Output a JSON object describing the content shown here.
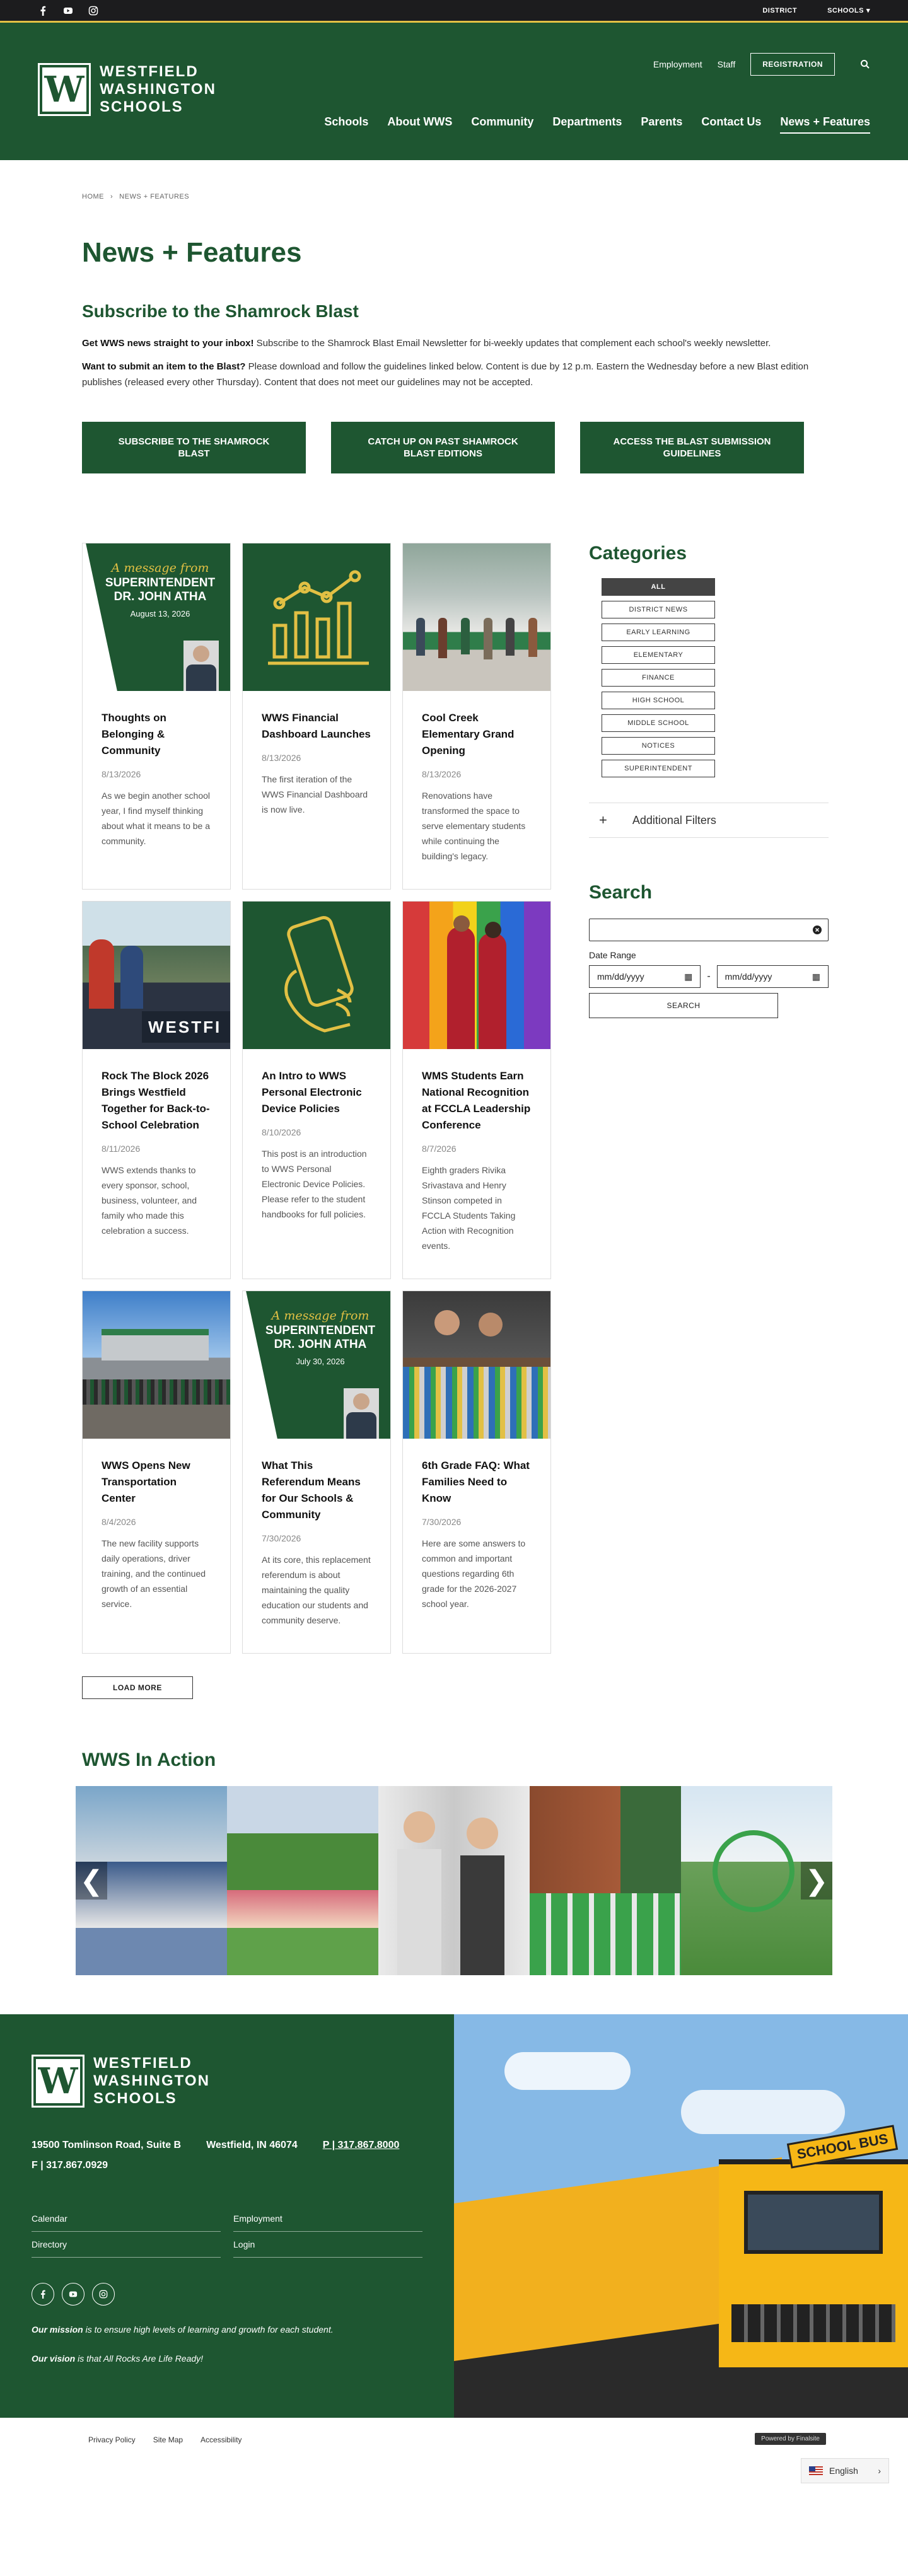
{
  "topbar": {
    "district": "DISTRICT",
    "schools": "SCHOOLS"
  },
  "brand": {
    "line1": "WESTFIELD",
    "line2": "WASHINGTON",
    "line3": "SCHOOLS",
    "mark": "W"
  },
  "util": {
    "employment": "Employment",
    "staff": "Staff",
    "registration": "REGISTRATION"
  },
  "nav": [
    "Schools",
    "About WWS",
    "Community",
    "Departments",
    "Parents",
    "Contact Us",
    "News + Features"
  ],
  "breadcrumb": {
    "home": "HOME",
    "current": "NEWS + FEATURES"
  },
  "page": {
    "title": "News + Features",
    "subtitle": "Subscribe to the Shamrock Blast",
    "p1_bold": "Get WWS news straight to your inbox!",
    "p1_text": " Subscribe to the Shamrock Blast Email Newsletter for bi-weekly updates that complement each school's weekly newsletter.",
    "p2_bold": "Want to submit an item to the Blast?",
    "p2_text": " Please download and follow the guidelines linked below. Content is due by 12 p.m. Eastern the Wednesday before a new Blast edition publishes (released every other Thursday). Content that does not meet our guidelines may not be accepted."
  },
  "ctas": [
    "SUBSCRIBE TO THE SHAMROCK BLAST",
    "CATCH UP ON PAST SHAMROCK BLAST EDITIONS",
    "ACCESS THE BLAST SUBMISSION GUIDELINES"
  ],
  "cards": [
    {
      "title": "Thoughts on Belonging & Community",
      "date": "8/13/2026",
      "desc": "As we begin another school year, I find myself thinking about what it means to be a community.",
      "msg": "A message from",
      "role": "SUPERINTENDENT",
      "name": "DR. JOHN ATHA",
      "mdate": "August 13, 2026"
    },
    {
      "title": "WWS Financial Dashboard Launches",
      "date": "8/13/2026",
      "desc": "The first iteration of the WWS Financial Dashboard is now live."
    },
    {
      "title": "Cool Creek Elementary Grand Opening",
      "date": "8/13/2026",
      "desc": "Renovations have transformed the space to serve elementary students while continuing the building's legacy."
    },
    {
      "title": "Rock The Block 2026 Brings Westfield Together for Back-to-School Celebration",
      "date": "8/11/2026",
      "desc": "WWS extends thanks to every sponsor, school, business, volunteer, and family who made this celebration a success.",
      "banner": "WESTFI"
    },
    {
      "title": "An Intro to WWS Personal Electronic Device Policies",
      "date": "8/10/2026",
      "desc": "This post is an introduction to WWS Personal Electronic Device Policies. Please refer to the student handbooks for full policies."
    },
    {
      "title": "WMS Students Earn National Recognition at FCCLA Leadership Conference",
      "date": "8/7/2026",
      "desc": "Eighth graders Rivika Srivastava and Henry Stinson competed in FCCLA Students Taking Action with Recognition events."
    },
    {
      "title": "WWS Opens New Transportation Center",
      "date": "8/4/2026",
      "desc": "The new facility supports daily operations, driver training, and the continued growth of an essential service."
    },
    {
      "title": "What This Referendum Means for Our Schools & Community",
      "date": "7/30/2026",
      "desc": "At its core, this replacement referendum is about maintaining the quality education our students and community deserve.",
      "msg": "A message from",
      "role": "SUPERINTENDENT",
      "name": "DR. JOHN ATHA",
      "mdate": "July 30, 2026"
    },
    {
      "title": "6th Grade FAQ: What Families Need to Know",
      "date": "7/30/2026",
      "desc": "Here are some answers to common and important questions regarding 6th grade for the 2026-2027 school year."
    }
  ],
  "load_more": "LOAD MORE",
  "sidebar": {
    "categories_title": "Categories",
    "categories": [
      "ALL",
      "DISTRICT NEWS",
      "EARLY LEARNING",
      "ELEMENTARY",
      "FINANCE",
      "HIGH SCHOOL",
      "MIDDLE SCHOOL",
      "NOTICES",
      "SUPERINTENDENT"
    ],
    "additional_filters": "Additional Filters",
    "search_title": "Search",
    "date_range": "Date Range",
    "date_placeholder": "mm/dd/yyyy",
    "dash": "-",
    "search_btn": "SEARCH"
  },
  "action": {
    "title": "WWS In Action"
  },
  "footer": {
    "address": "19500 Tomlinson Road, Suite B",
    "city": "Westfield, IN  46074",
    "phone": "P | 317.867.8000",
    "fax": "F | 317.867.0929",
    "links": [
      "Calendar",
      "Employment",
      "Directory",
      "Login"
    ],
    "mission_b": "Our mission",
    "mission": " is to ensure high levels of learning and growth for each student.",
    "vision_b": "Our vision",
    "vision": " is that All Rocks Are Life Ready!",
    "bus": "SCHOOL BUS"
  },
  "bottom": {
    "links": [
      "Privacy Policy",
      "Site Map",
      "Accessibility"
    ],
    "powered": "Powered by Finalsite",
    "lang": "English"
  },
  "colors": {
    "green": "#1e5631",
    "gold": "#e2c044",
    "dark": "#1c1c1e"
  }
}
